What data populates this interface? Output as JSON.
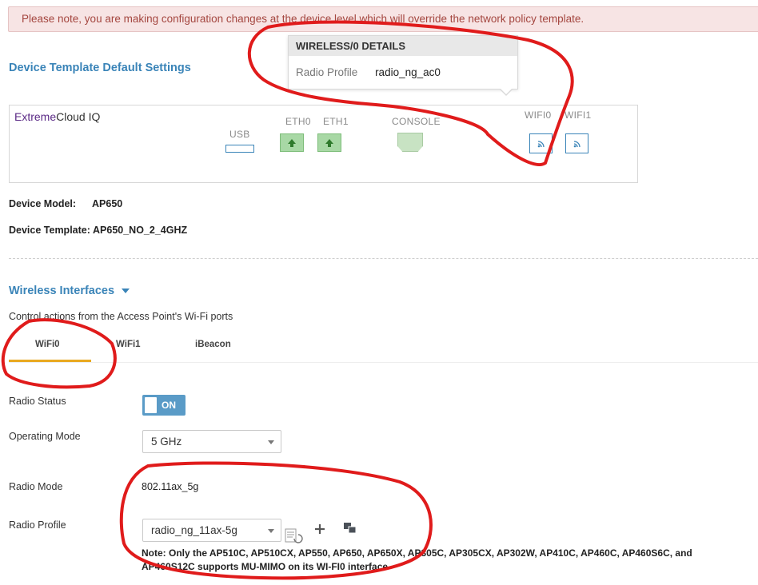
{
  "banner": {
    "text": "Please note, you are making configuration changes at the device level which will override the network policy template."
  },
  "device_settings": {
    "title": "Device Template Default Settings",
    "brand_prefix": "Extreme",
    "brand_suffix": "Cloud IQ",
    "ports": {
      "usb": "USB",
      "eth0": "ETH0",
      "eth1": "ETH1",
      "console": "CONSOLE",
      "wifi0": "WIFI0",
      "wifi1": "WIFI1"
    }
  },
  "popover": {
    "title": "WIRELESS/0 DETAILS",
    "key": "Radio Profile",
    "value": "radio_ng_ac0"
  },
  "device_info": {
    "model_label": "Device Model:",
    "model_value": "AP650",
    "template_label": "Device Template:",
    "template_value": "AP650_NO_2_4GHZ"
  },
  "wireless": {
    "title": "Wireless Interfaces",
    "description": "Control actions from the Access Point's Wi-Fi ports",
    "tabs": [
      "WiFi0",
      "WiFi1",
      "iBeacon"
    ],
    "active_tab": "WiFi0"
  },
  "form": {
    "radio_status_label": "Radio Status",
    "radio_status_value": "ON",
    "operating_mode_label": "Operating Mode",
    "operating_mode_value": "5 GHz",
    "radio_mode_label": "Radio Mode",
    "radio_mode_value": "802.11ax_5g",
    "radio_profile_label": "Radio Profile",
    "radio_profile_value": "radio_ng_11ax-5g",
    "note_line1": "Note: Only the AP510C, AP510CX, AP550, AP650, AP650X, AP305C, AP305CX, AP302W, AP410C, AP460C, AP460S6C, and",
    "note_line2": "AP460S12C supports MU-MIMO on its WI-FI0 interface"
  },
  "colors": {
    "accent": "#3a84b8",
    "tab_underline": "#e9a920",
    "toggle_on": "#5a9bc7",
    "port_green": "#a8d8a5",
    "annotation_red": "#e01b1b"
  }
}
